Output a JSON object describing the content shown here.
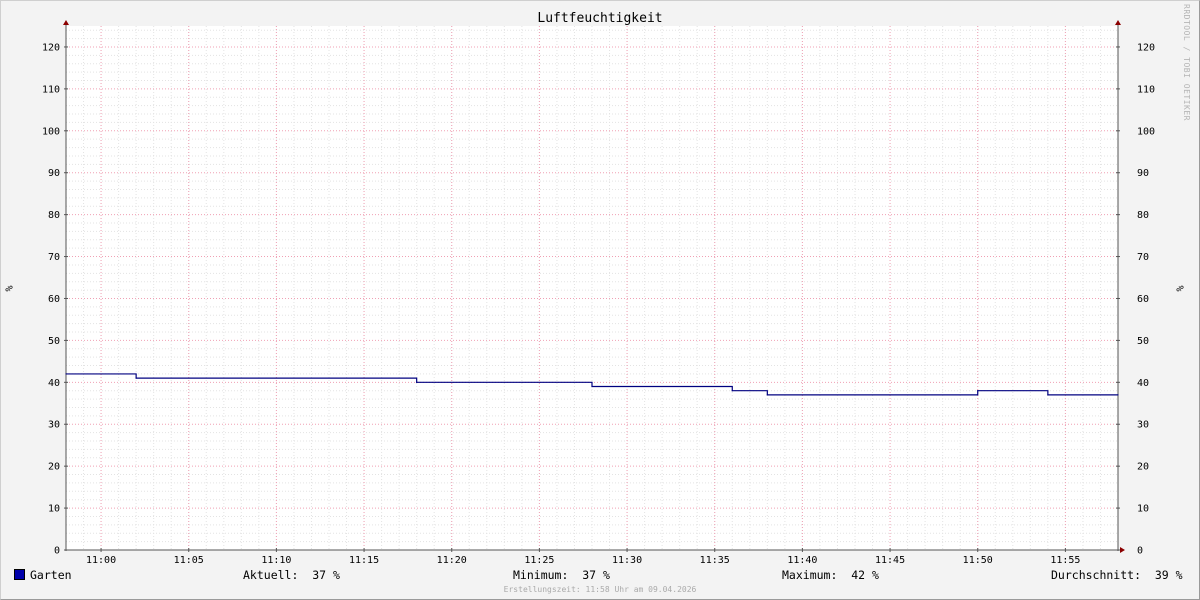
{
  "chart_data": {
    "type": "line",
    "title": "Luftfeuchtigkeit",
    "ylabel": "%",
    "ylim": [
      0,
      125
    ],
    "y_ticks": [
      0,
      10,
      20,
      30,
      40,
      50,
      60,
      70,
      80,
      90,
      100,
      110,
      120
    ],
    "xlim": [
      "10:58",
      "11:58"
    ],
    "x_tick_labels": [
      "11:00",
      "11:05",
      "11:10",
      "11:15",
      "11:20",
      "11:25",
      "11:30",
      "11:35",
      "11:40",
      "11:45",
      "11:50",
      "11:55"
    ],
    "grid": true,
    "series": [
      {
        "name": "Garten",
        "color": "#000080",
        "step": true,
        "x": [
          "10:58",
          "11:02",
          "11:18",
          "11:28",
          "11:36",
          "11:38",
          "11:50",
          "11:54",
          "11:58"
        ],
        "y": [
          42,
          41,
          40,
          39,
          38,
          37,
          38,
          37,
          37
        ]
      }
    ]
  },
  "legend": {
    "series_name": "Garten",
    "swatch_color": "#0000aa",
    "current": "Aktuell:  37 %",
    "minimum": "Minimum:  37 %",
    "maximum": "Maximum:  42 %",
    "average": "Durchschnitt:  39 %"
  },
  "watermark": "RRDTOOL / TOBI OETIKER",
  "footer": "Erstellungszeit: 11:58 Uhr am 09.04.2026"
}
